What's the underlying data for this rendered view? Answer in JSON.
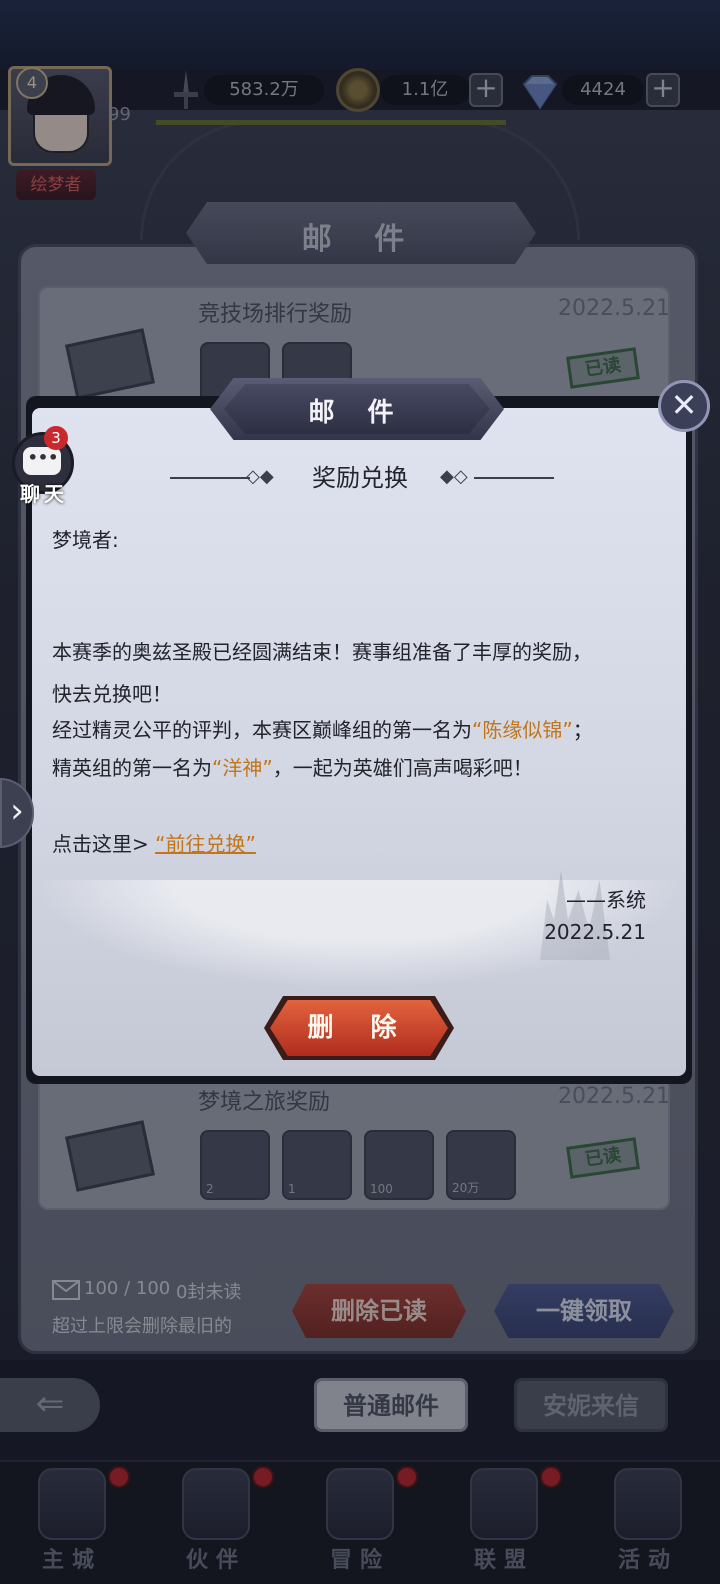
{
  "hud": {
    "level": "4",
    "vip": "99",
    "player_title": "绘梦者",
    "power": "583.2万",
    "gold": "1.1亿",
    "diamonds": "4424",
    "plus": "+"
  },
  "mail_list": {
    "header": "邮 件",
    "items": [
      {
        "title": "竞技场排行奖励",
        "date": "2022.5.21",
        "status": "已读"
      },
      {
        "title": "梦境之旅奖励",
        "date": "2022.5.21",
        "status": "已读",
        "slots": [
          "2",
          "1",
          "100",
          "20万"
        ]
      }
    ],
    "count_label": "100 / 100",
    "unread_label": "0封未读",
    "limit_note": "超过上限会删除最旧的",
    "delete_read_button": "删除已读",
    "collect_all_button": "一键领取"
  },
  "tabs": {
    "back_icon": "⇐",
    "normal_mail": "普通邮件",
    "annie_mail": "安妮来信"
  },
  "chat": {
    "badge": "3",
    "label": "聊天",
    "dots": "•••"
  },
  "side_arrow": "›",
  "modal": {
    "banner": "邮 件",
    "close_icon": "✕",
    "subject": "奖励兑换",
    "greeting": "梦境者:",
    "para1": "本赛季的奥兹圣殿已经圆满结束！赛事组准备了丰厚的奖励，",
    "para2": "快去兑换吧！",
    "para3_a": "经过精灵公平的评判，本赛区巅峰组的第一名为",
    "para3_hl": "“陈缘似锦”",
    "para3_b": "；",
    "para4_a": "精英组的第一名为",
    "para4_hl": "“洋神”",
    "para4_b": "，一起为英雄们高声喝彩吧！",
    "link_prefix": "点击这里>",
    "link_text": "“前往兑换”",
    "sign_name": "——系统",
    "sign_date": "2022.5.21",
    "delete_button": "删 除"
  },
  "bottom_nav": [
    {
      "label": "主城"
    },
    {
      "label": "伙伴"
    },
    {
      "label": "冒险"
    },
    {
      "label": "联盟"
    },
    {
      "label": "活动"
    }
  ]
}
